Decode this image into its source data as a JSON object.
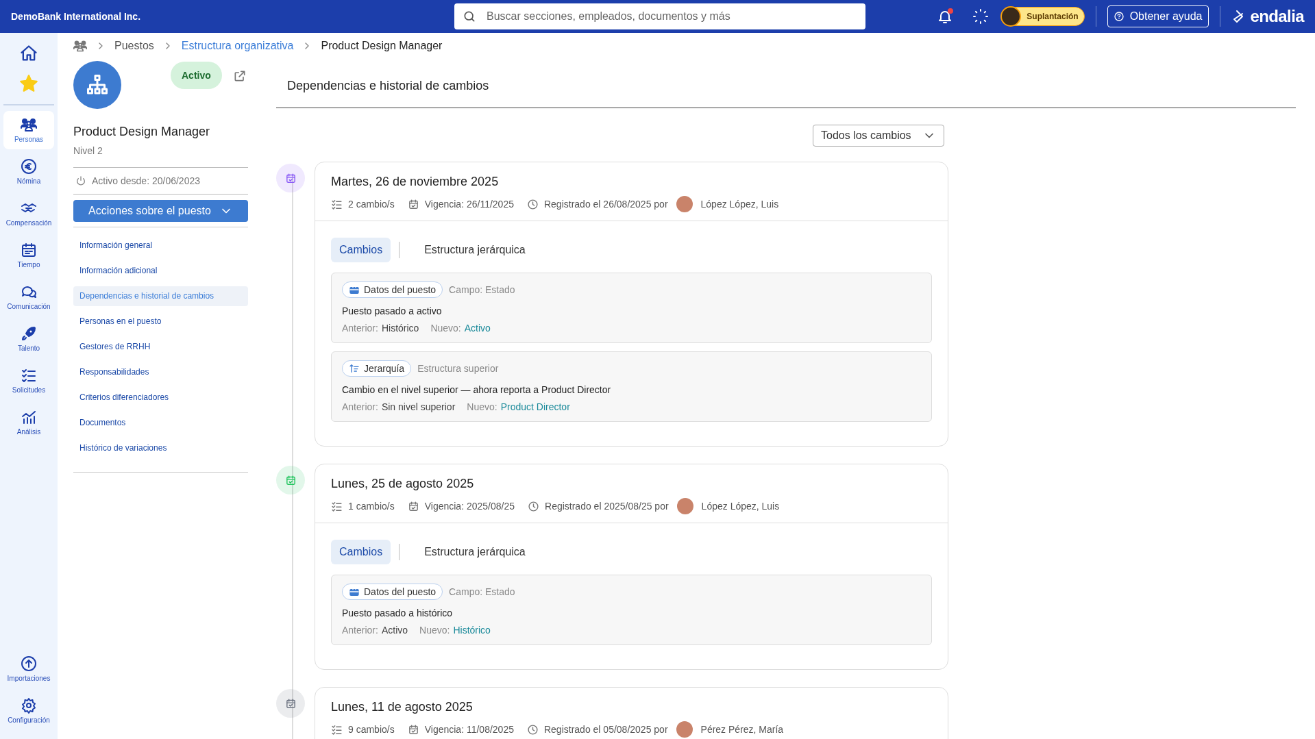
{
  "topbar": {
    "company": "DemoBank International Inc.",
    "search": {
      "placeholder": "Buscar secciones, empleados, documentos y más"
    },
    "notifications": {
      "unread": true
    },
    "impersonation": "Suplantación",
    "help": "Obtener ayuda",
    "brand": "endalia"
  },
  "nav": {
    "top": [
      {
        "kind": "home"
      },
      {
        "kind": "favorites"
      }
    ],
    "items": [
      {
        "kind": "people",
        "label": "Personas",
        "selected": true
      },
      {
        "kind": "payroll",
        "label": "Nómina",
        "selected": false
      },
      {
        "kind": "compensation",
        "label": "Compensación",
        "selected": false
      },
      {
        "kind": "time",
        "label": "Tiempo",
        "selected": false
      },
      {
        "kind": "communication",
        "label": "Comunicación",
        "selected": false
      },
      {
        "kind": "talent",
        "label": "Talento",
        "selected": false
      },
      {
        "kind": "requests",
        "label": "Solicitudes",
        "selected": false
      },
      {
        "kind": "analytics",
        "label": "Análisis",
        "selected": false
      }
    ],
    "bottom": [
      {
        "kind": "imports",
        "label": "Importaciones",
        "selected": false
      },
      {
        "kind": "settings",
        "label": "Configuración",
        "selected": false
      }
    ]
  },
  "breadcrumb": [
    {
      "label": "Puestos",
      "link": false
    },
    {
      "label": "Estructura organizativa",
      "link": true
    },
    {
      "label": "Product Design Manager",
      "link": false
    }
  ],
  "position": {
    "status": "Activo",
    "title": "Product Design Manager",
    "level": "Nivel 2",
    "active_since": "Activo desde: 20/06/2023",
    "actions": "Acciones sobre el puesto",
    "menu": [
      {
        "label": "Información general",
        "selected": false
      },
      {
        "label": "Información adicional",
        "selected": false
      },
      {
        "label": "Dependencias e historial de cambios",
        "selected": true
      },
      {
        "label": "Personas en el puesto",
        "selected": false
      },
      {
        "label": "Gestores de RRHH",
        "selected": false
      },
      {
        "label": "Responsabilidades",
        "selected": false
      },
      {
        "label": "Criterios diferenciadores",
        "selected": false
      },
      {
        "label": "Documentos",
        "selected": false
      },
      {
        "label": "Histórico de variaciones",
        "selected": false
      }
    ]
  },
  "section_title": "Dependencias e historial de cambios",
  "filter": "Todos los cambios",
  "events": [
    {
      "color": "#8b5cf6",
      "date": "Martes, 26 de noviembre 2025",
      "count": "2 cambio/s",
      "effective": "Vigencia: 26/11/2025",
      "registered": "Registrado el 26/08/2025 por",
      "author": "López López, Luis",
      "tabs": [
        {
          "label": "Cambios",
          "selected": true
        },
        {
          "label": "Estructura jerárquica",
          "selected": false
        }
      ],
      "changes": [
        {
          "kind": "data",
          "badge": "Datos del puesto",
          "field": "Campo: Estado",
          "description": "Puesto pasado a activo",
          "previous_label": "Anterior:",
          "previous": "Histórico",
          "new_label": "Nuevo:",
          "new": "Activo"
        },
        {
          "kind": "hierarchy",
          "badge": "Jerarquía",
          "field": "Estructura superior",
          "description": "Cambio en el nivel superior — ahora reporta a Product Director",
          "previous_label": "Anterior:",
          "previous": "Sin nivel superior",
          "new_label": "Nuevo:",
          "new": "Product Director"
        }
      ]
    },
    {
      "color": "#22c55e",
      "date": "Lunes, 25 de agosto 2025",
      "count": "1 cambio/s",
      "effective": "Vigencia: 2025/08/25",
      "registered": "Registrado el 2025/08/25 por",
      "author": "López López, Luis",
      "tabs": [
        {
          "label": "Cambios",
          "selected": true
        },
        {
          "label": "Estructura jerárquica",
          "selected": false
        }
      ],
      "changes": [
        {
          "kind": "data",
          "badge": "Datos del puesto",
          "field": "Campo: Estado",
          "description": "Puesto pasado a histórico",
          "previous_label": "Anterior:",
          "previous": "Activo",
          "new_label": "Nuevo:",
          "new": "Histórico"
        }
      ]
    },
    {
      "color": "#6b7280",
      "date": "Lunes, 11 de agosto 2025",
      "count": "9 cambio/s",
      "effective": "Vigencia: 11/08/2025",
      "registered": "Registrado el 05/08/2025 por",
      "author": "Pérez Pérez, María"
    }
  ]
}
